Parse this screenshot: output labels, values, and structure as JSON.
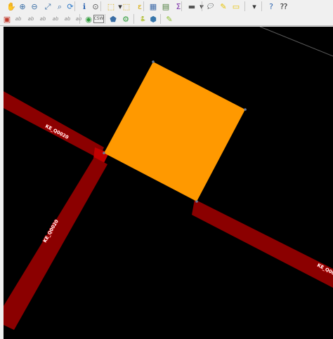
{
  "toolbar": {
    "row1": [
      {
        "icon": "pan-icon",
        "glyph": "✋",
        "color": "#d9b400"
      },
      {
        "icon": "zoom-in-icon",
        "glyph": "⊕",
        "color": "#3a6ea5"
      },
      {
        "icon": "zoom-out-icon",
        "glyph": "⊖",
        "color": "#3a6ea5"
      },
      {
        "icon": "zoom-full-icon",
        "glyph": "⤢",
        "color": "#3a6ea5"
      },
      {
        "icon": "zoom-to-layer-icon",
        "glyph": "⌕",
        "color": "#3a6ea5"
      },
      {
        "icon": "refresh-icon",
        "glyph": "⟳",
        "color": "#2a78c8"
      },
      {
        "icon": "identify-icon",
        "glyph": "ℹ",
        "color": "#2a62b0"
      },
      {
        "icon": "pan-to-selection-icon",
        "glyph": "⊙",
        "color": "#555555"
      },
      {
        "icon": "select-features-icon",
        "glyph": "⬚",
        "color": "#d7a800"
      },
      {
        "icon": "select-dropdown-icon",
        "glyph": "▾",
        "color": "#333333"
      },
      {
        "icon": "deselect-icon",
        "glyph": "⬚",
        "color": "#d7a800"
      },
      {
        "icon": "select-by-expression-icon",
        "glyph": "ε",
        "color": "#d7a800"
      },
      {
        "icon": "attribute-table-icon",
        "glyph": "▦",
        "color": "#3d6aa8"
      },
      {
        "icon": "field-calculator-icon",
        "glyph": "▤",
        "color": "#4a7c3a"
      },
      {
        "icon": "statistics-icon",
        "glyph": "Σ",
        "color": "#7b2fa8"
      },
      {
        "icon": "measure-icon",
        "glyph": "▬",
        "color": "#555555"
      },
      {
        "icon": "measure-dropdown-icon",
        "glyph": "▾",
        "color": "#333333"
      },
      {
        "icon": "annotation-icon",
        "glyph": "💬",
        "color": "#e6c200"
      },
      {
        "icon": "text-annotation-icon",
        "glyph": "✎",
        "color": "#e6c200"
      },
      {
        "icon": "label-icon",
        "glyph": "▭",
        "color": "#e6c200"
      },
      {
        "icon": "layout-dropdown-icon",
        "glyph": "▾",
        "color": "#333333"
      },
      {
        "icon": "help-icon",
        "glyph": "?",
        "color": "#2a62b0"
      },
      {
        "icon": "whats-this-icon",
        "glyph": "⁇",
        "color": "#222222"
      }
    ],
    "row2": [
      {
        "icon": "layer-style-icon",
        "glyph": "▣",
        "color": "#c0392b"
      },
      {
        "icon": "label-tool-1-icon",
        "glyph": "ab",
        "color": "#888888"
      },
      {
        "icon": "label-tool-2-icon",
        "glyph": "ab",
        "color": "#888888"
      },
      {
        "icon": "label-tool-3-icon",
        "glyph": "ab",
        "color": "#888888"
      },
      {
        "icon": "label-tool-4-icon",
        "glyph": "ab",
        "color": "#888888"
      },
      {
        "icon": "label-tool-5-icon",
        "glyph": "ab",
        "color": "#888888"
      },
      {
        "icon": "label-tool-6-icon",
        "glyph": "ab",
        "color": "#888888"
      },
      {
        "icon": "openstreetmap-icon",
        "glyph": "◉",
        "color": "#2e9b3a"
      },
      {
        "icon": "csw-icon",
        "glyph": "CSW",
        "color": "#555555"
      },
      {
        "icon": "plugin-icon",
        "glyph": "⬟",
        "color": "#3a6ea5"
      },
      {
        "icon": "processing-icon",
        "glyph": "⚙",
        "color": "#2e9b3a"
      },
      {
        "icon": "python-console-icon",
        "glyph": "🐍",
        "color": "#3776ab"
      },
      {
        "icon": "python-plugin-icon",
        "glyph": "⬢",
        "color": "#3776ab"
      },
      {
        "icon": "edit-pencil-icon",
        "glyph": "✎",
        "color": "#8cbf2a"
      }
    ]
  },
  "map": {
    "background": "#000000",
    "polygon_fill": "#ff9900",
    "road_fill": "#8b0000",
    "road_labels": [
      "KE_Q0020",
      "KE_Q0020",
      "KE_Q00"
    ]
  }
}
